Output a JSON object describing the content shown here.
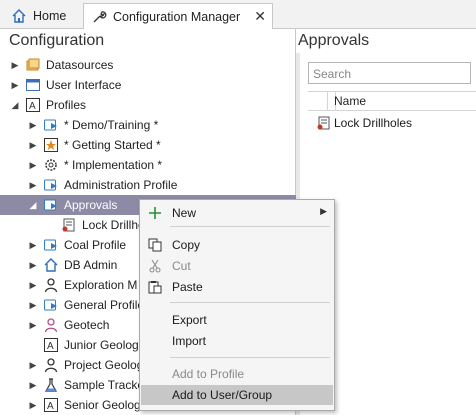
{
  "tabs": {
    "home": "Home",
    "config": "Configuration Manager",
    "close": "✕"
  },
  "left": {
    "title": "Configuration"
  },
  "tree": [
    {
      "label": "Datasources",
      "exp": "▶",
      "icon": "datasources-icon"
    },
    {
      "label": "User Interface",
      "exp": "▶",
      "icon": "window-icon"
    },
    {
      "label": "Profiles",
      "exp": "◢",
      "icon": "profile-icon"
    },
    {
      "label": "* Demo/Training *",
      "exp": "▶",
      "icon": "profile-group-icon"
    },
    {
      "label": "* Getting Started *",
      "exp": "▶",
      "icon": "star-icon"
    },
    {
      "label": "* Implementation *",
      "exp": "▶",
      "icon": "gear-icon"
    },
    {
      "label": "Administration Profile",
      "exp": "▶",
      "icon": "profile-group-icon"
    },
    {
      "label": "Approvals",
      "exp": "◢",
      "icon": "profile-group-icon"
    },
    {
      "label": "Lock Drillho",
      "exp": "",
      "icon": "lock-drillholes-icon"
    },
    {
      "label": "Coal Profile",
      "exp": "▶",
      "icon": "profile-group-icon"
    },
    {
      "label": "DB Admin",
      "exp": "▶",
      "icon": "home-icon"
    },
    {
      "label": "Exploration M",
      "exp": "▶",
      "icon": "person-icon"
    },
    {
      "label": "General Profile",
      "exp": "▶",
      "icon": "profile-group-icon"
    },
    {
      "label": "Geotech",
      "exp": "▶",
      "icon": "person-pink-icon"
    },
    {
      "label": "Junior Geolog",
      "exp": "",
      "icon": "profile-icon"
    },
    {
      "label": "Project Geolog",
      "exp": "▶",
      "icon": "person-icon"
    },
    {
      "label": "Sample Tracke",
      "exp": "▶",
      "icon": "flask-icon"
    },
    {
      "label": "Senior Geolog",
      "exp": "▶",
      "icon": "profile-icon"
    }
  ],
  "right": {
    "title": "Approvals",
    "search_placeholder": "Search",
    "column_name": "Name",
    "items": [
      "Lock Drillholes"
    ]
  },
  "menu": {
    "new": "New",
    "copy": "Copy",
    "cut": "Cut",
    "paste": "Paste",
    "export": "Export",
    "import": "Import",
    "add_to_profile": "Add to Profile",
    "add_to_user_group": "Add to User/Group"
  }
}
